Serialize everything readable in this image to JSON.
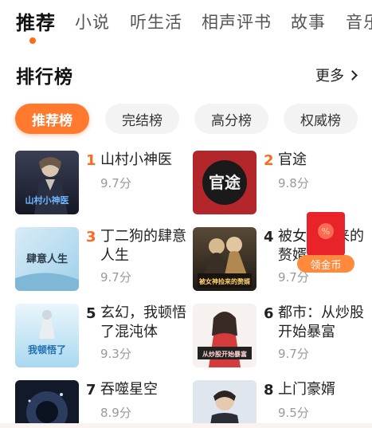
{
  "tabs": [
    {
      "label": "推荐",
      "active": true
    },
    {
      "label": "小说"
    },
    {
      "label": "听生活"
    },
    {
      "label": "相声评书"
    },
    {
      "label": "故事"
    },
    {
      "label": "音乐"
    }
  ],
  "section": {
    "title": "排行榜",
    "more_label": "更多"
  },
  "chips": [
    {
      "label": "推荐榜",
      "active": true
    },
    {
      "label": "完结榜"
    },
    {
      "label": "高分榜"
    },
    {
      "label": "权威榜"
    }
  ],
  "books": [
    {
      "rank": "1",
      "title": "山村小神医",
      "score": "9.7分",
      "cover_text": "山村小神医"
    },
    {
      "rank": "2",
      "title": "官途",
      "score": "9.8分",
      "cover_text": "官途"
    },
    {
      "rank": "3",
      "title": "丁二狗的肆意人生",
      "score": "9.7分",
      "cover_text": "肆意人生"
    },
    {
      "rank": "4",
      "title": "被女神捡来的赘婿",
      "score": "9.7分",
      "cover_text": "被女神捡来的赘婿"
    },
    {
      "rank": "5",
      "title": "玄幻，我顿悟了混沌体",
      "score": "9.3分",
      "cover_text": "我顿悟了"
    },
    {
      "rank": "6",
      "title": "都市：从炒股开始暴富",
      "score": "9.7分",
      "cover_text": "从炒股开始暴富"
    },
    {
      "rank": "7",
      "title": "吞噬星空",
      "score": "8.9分",
      "cover_text": ""
    },
    {
      "rank": "8",
      "title": "上门豪婿",
      "score": "9.5分",
      "cover_text": ""
    }
  ],
  "envelope": {
    "label": "领金币",
    "coin_glyph": "%"
  },
  "colors": {
    "accent": "#ff6a1a",
    "envelope_red": "#e8232a"
  }
}
